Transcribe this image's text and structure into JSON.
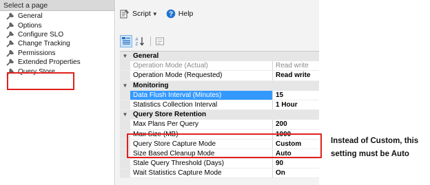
{
  "left_pane": {
    "header": "Select a page",
    "items": [
      {
        "label": "General"
      },
      {
        "label": "Options"
      },
      {
        "label": "Configure SLO"
      },
      {
        "label": "Change Tracking"
      },
      {
        "label": "Permissions"
      },
      {
        "label": "Extended Properties"
      },
      {
        "label": "Query Store"
      }
    ],
    "selected_item": "Query Store"
  },
  "toolbar": {
    "script_label": "Script",
    "help_label": "Help"
  },
  "property_grid": {
    "categories": [
      {
        "name": "General",
        "properties": [
          {
            "name": "Operation Mode (Actual)",
            "value": "Read write"
          },
          {
            "name": "Operation Mode (Requested)",
            "value": "Read write"
          }
        ]
      },
      {
        "name": "Monitoring",
        "properties": [
          {
            "name": "Data Flush Interval (Minutes)",
            "value": "15"
          },
          {
            "name": "Statistics Collection Interval",
            "value": "1 Hour"
          }
        ]
      },
      {
        "name": "Query Store Retention",
        "properties": [
          {
            "name": "Max Plans Per Query",
            "value": "200"
          },
          {
            "name": "Max Size (MB)",
            "value": "1000"
          },
          {
            "name": "Query Store Capture Mode",
            "value": "Custom"
          },
          {
            "name": "Size Based Cleanup Mode",
            "value": "Auto"
          },
          {
            "name": "Stale Query Threshold (Days)",
            "value": "90"
          },
          {
            "name": "Wait Statistics Capture Mode",
            "value": "On"
          }
        ]
      }
    ]
  },
  "annotation": {
    "line1": "Instead of Custom, this",
    "line2": "setting must be Auto"
  },
  "colors": {
    "highlight_red": "#e0201b",
    "selected_blue": "#3399ff"
  }
}
